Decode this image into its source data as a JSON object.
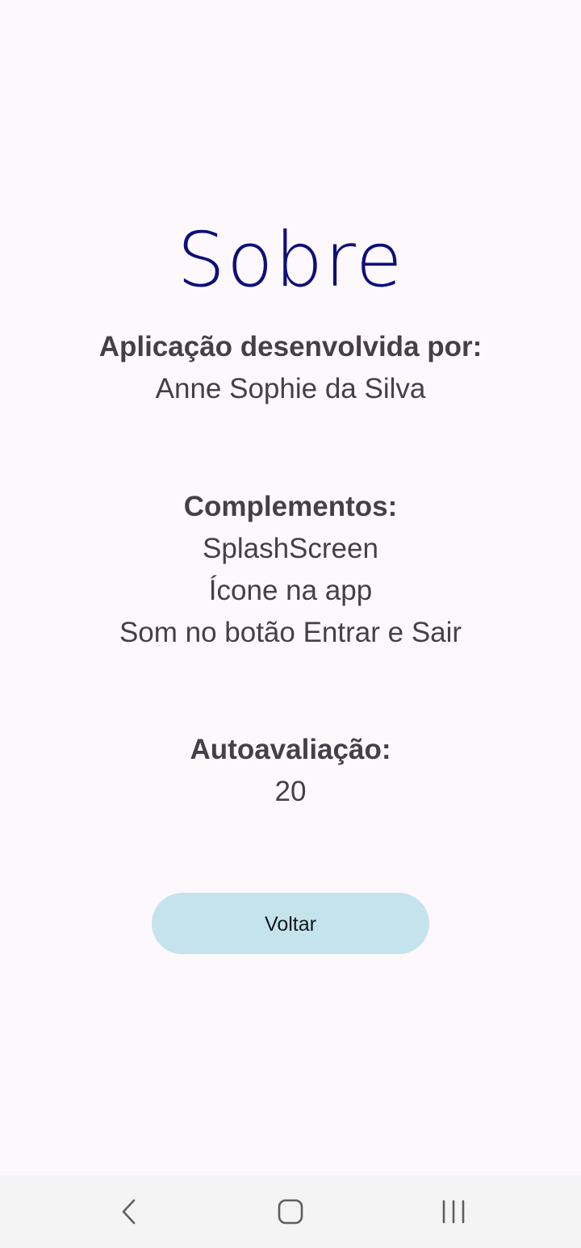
{
  "screen": {
    "title": "Sobre",
    "developer": {
      "heading": "Aplicação desenvolvida por:",
      "name": "Anne Sophie da Silva"
    },
    "complements": {
      "heading": "Complementos:",
      "items": [
        "SplashScreen",
        "Ícone na app",
        "Som no botão Entrar e Sair"
      ]
    },
    "self_evaluation": {
      "heading": "Autoavaliação:",
      "value": "20"
    },
    "back_button_label": "Voltar"
  },
  "colors": {
    "background": "#fdf8fc",
    "title": "#0d0f7a",
    "text": "#463f47",
    "button": "#c5e3ed",
    "navbar": "#f4f4f4"
  },
  "navbar": {
    "icons": [
      "back-icon",
      "home-icon",
      "recents-icon"
    ]
  }
}
